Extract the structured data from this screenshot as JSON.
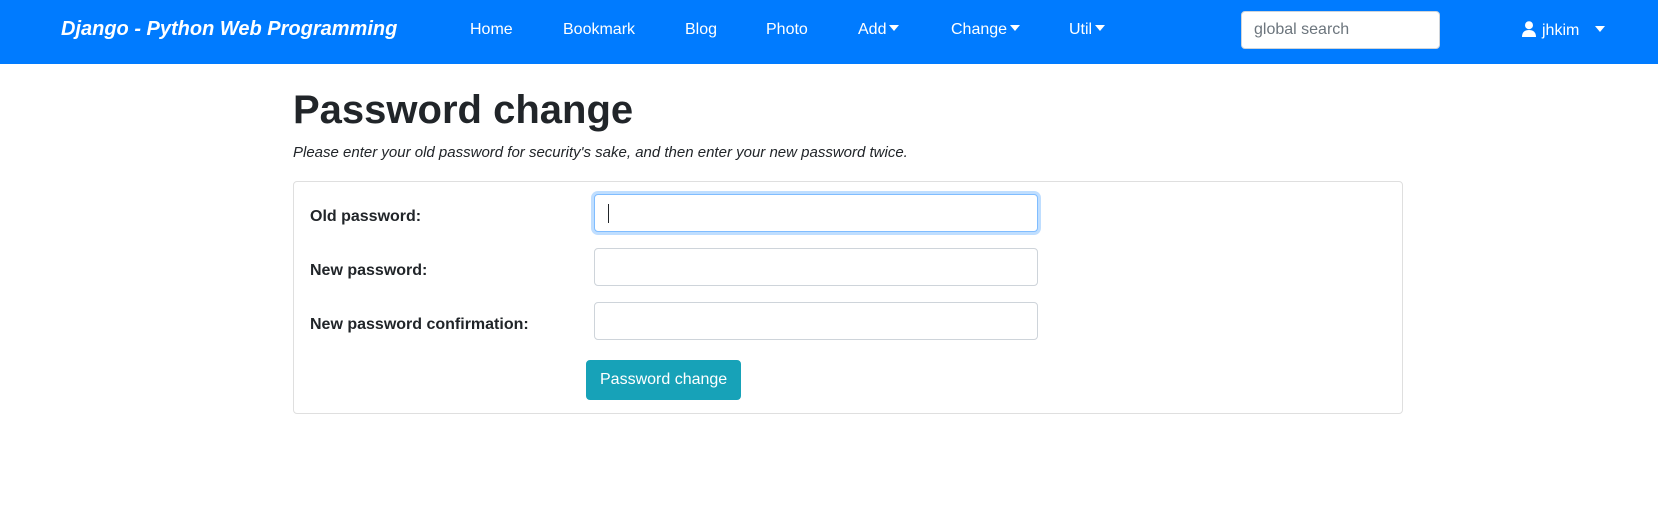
{
  "navbar": {
    "brand": "Django - Python Web Programming",
    "links": [
      {
        "label": "Home"
      },
      {
        "label": "Bookmark"
      },
      {
        "label": "Blog"
      },
      {
        "label": "Photo"
      },
      {
        "label": "Add",
        "dropdown": true
      },
      {
        "label": "Change",
        "dropdown": true
      },
      {
        "label": "Util",
        "dropdown": true
      }
    ],
    "search_placeholder": "global search",
    "search_value": "",
    "user": {
      "name": "jhkim",
      "icon": "user-icon"
    },
    "bg_color": "#007bff"
  },
  "page": {
    "title": "Password change",
    "help_text": "Please enter your old password for security's sake, and then enter your new password twice."
  },
  "form": {
    "fields": [
      {
        "label": "Old password:",
        "value": "",
        "focused": true
      },
      {
        "label": "New password:",
        "value": ""
      },
      {
        "label": "New password confirmation:",
        "value": ""
      }
    ],
    "submit_label": "Password change",
    "submit_color": "#17a2b8"
  }
}
